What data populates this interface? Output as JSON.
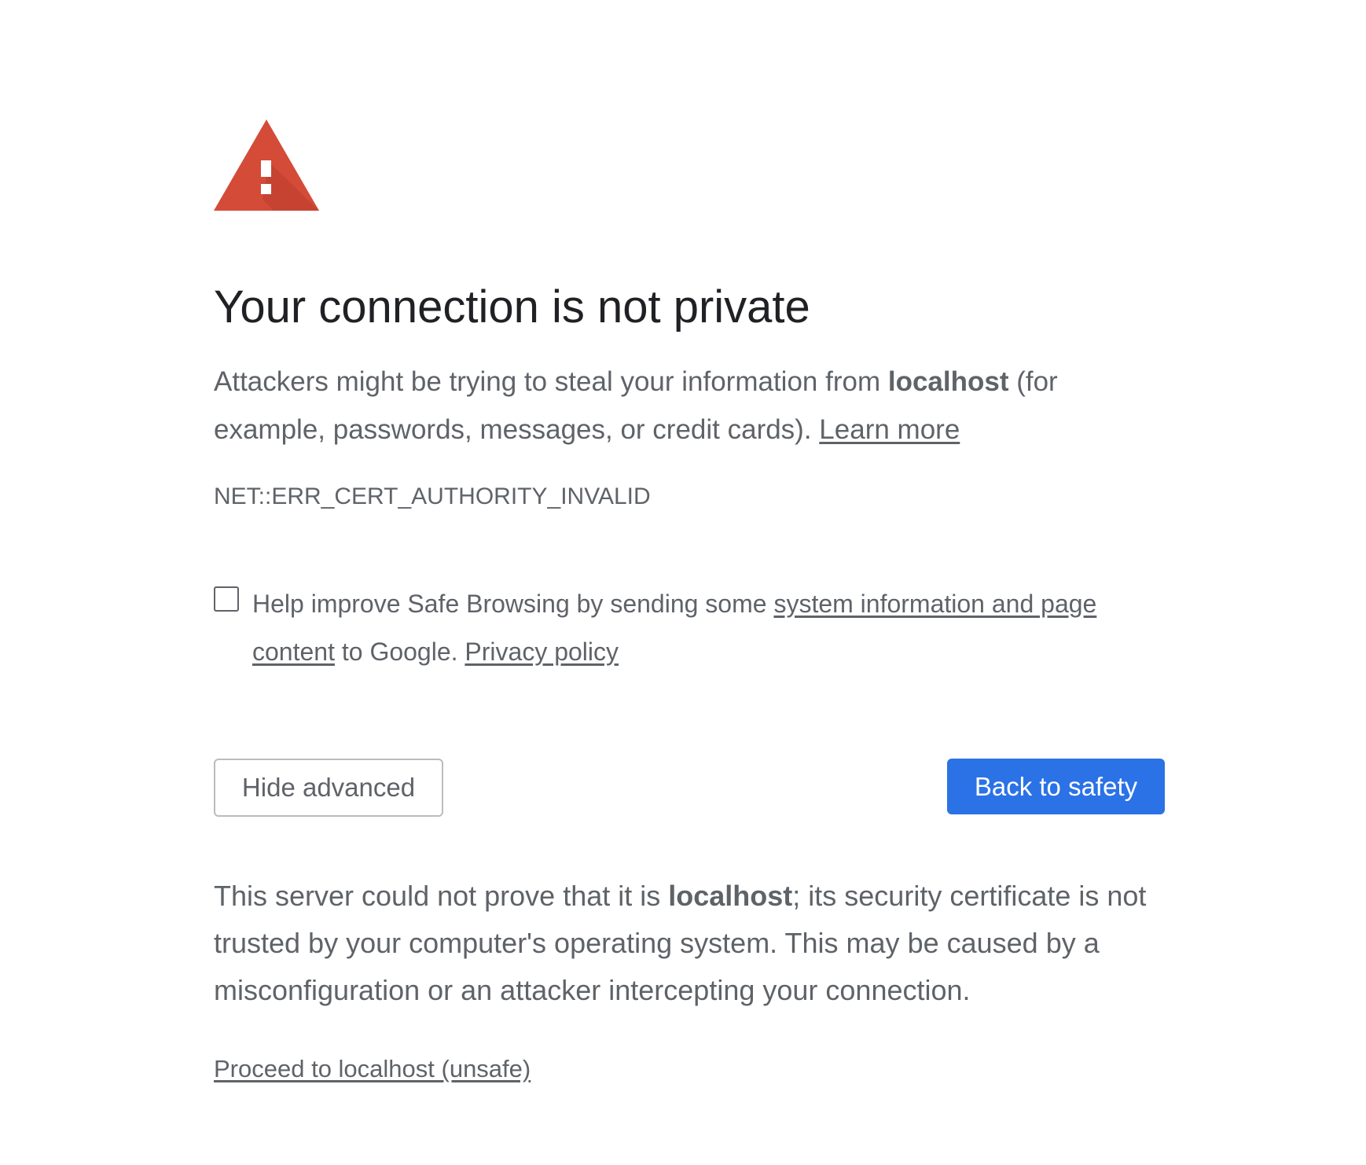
{
  "colors": {
    "icon_red": "#d44b38",
    "title_text": "#202124",
    "body_text": "#5f6368",
    "primary_button": "#2b72e6"
  },
  "icon": {
    "name": "warning-triangle-icon"
  },
  "title": "Your connection is not private",
  "explanation": {
    "prefix": "Attackers might be trying to steal your information from ",
    "host": "localhost",
    "suffix": " (for example, passwords, messages, or credit cards). ",
    "learn_more": "Learn more"
  },
  "error_code": "NET::ERR_CERT_AUTHORITY_INVALID",
  "safe_browsing": {
    "checked": false,
    "prefix": "Help improve Safe Browsing by sending some ",
    "link_system_info": "system information and page content",
    "middle": " to Google. ",
    "privacy_policy": "Privacy policy"
  },
  "buttons": {
    "hide_advanced": "Hide advanced",
    "back_to_safety": "Back to safety"
  },
  "details": {
    "prefix": "This server could not prove that it is ",
    "host": "localhost",
    "suffix": "; its security certificate is not trusted by your computer's operating system. This may be caused by a misconfiguration or an attacker intercepting your connection."
  },
  "proceed_link": "Proceed to localhost (unsafe)"
}
